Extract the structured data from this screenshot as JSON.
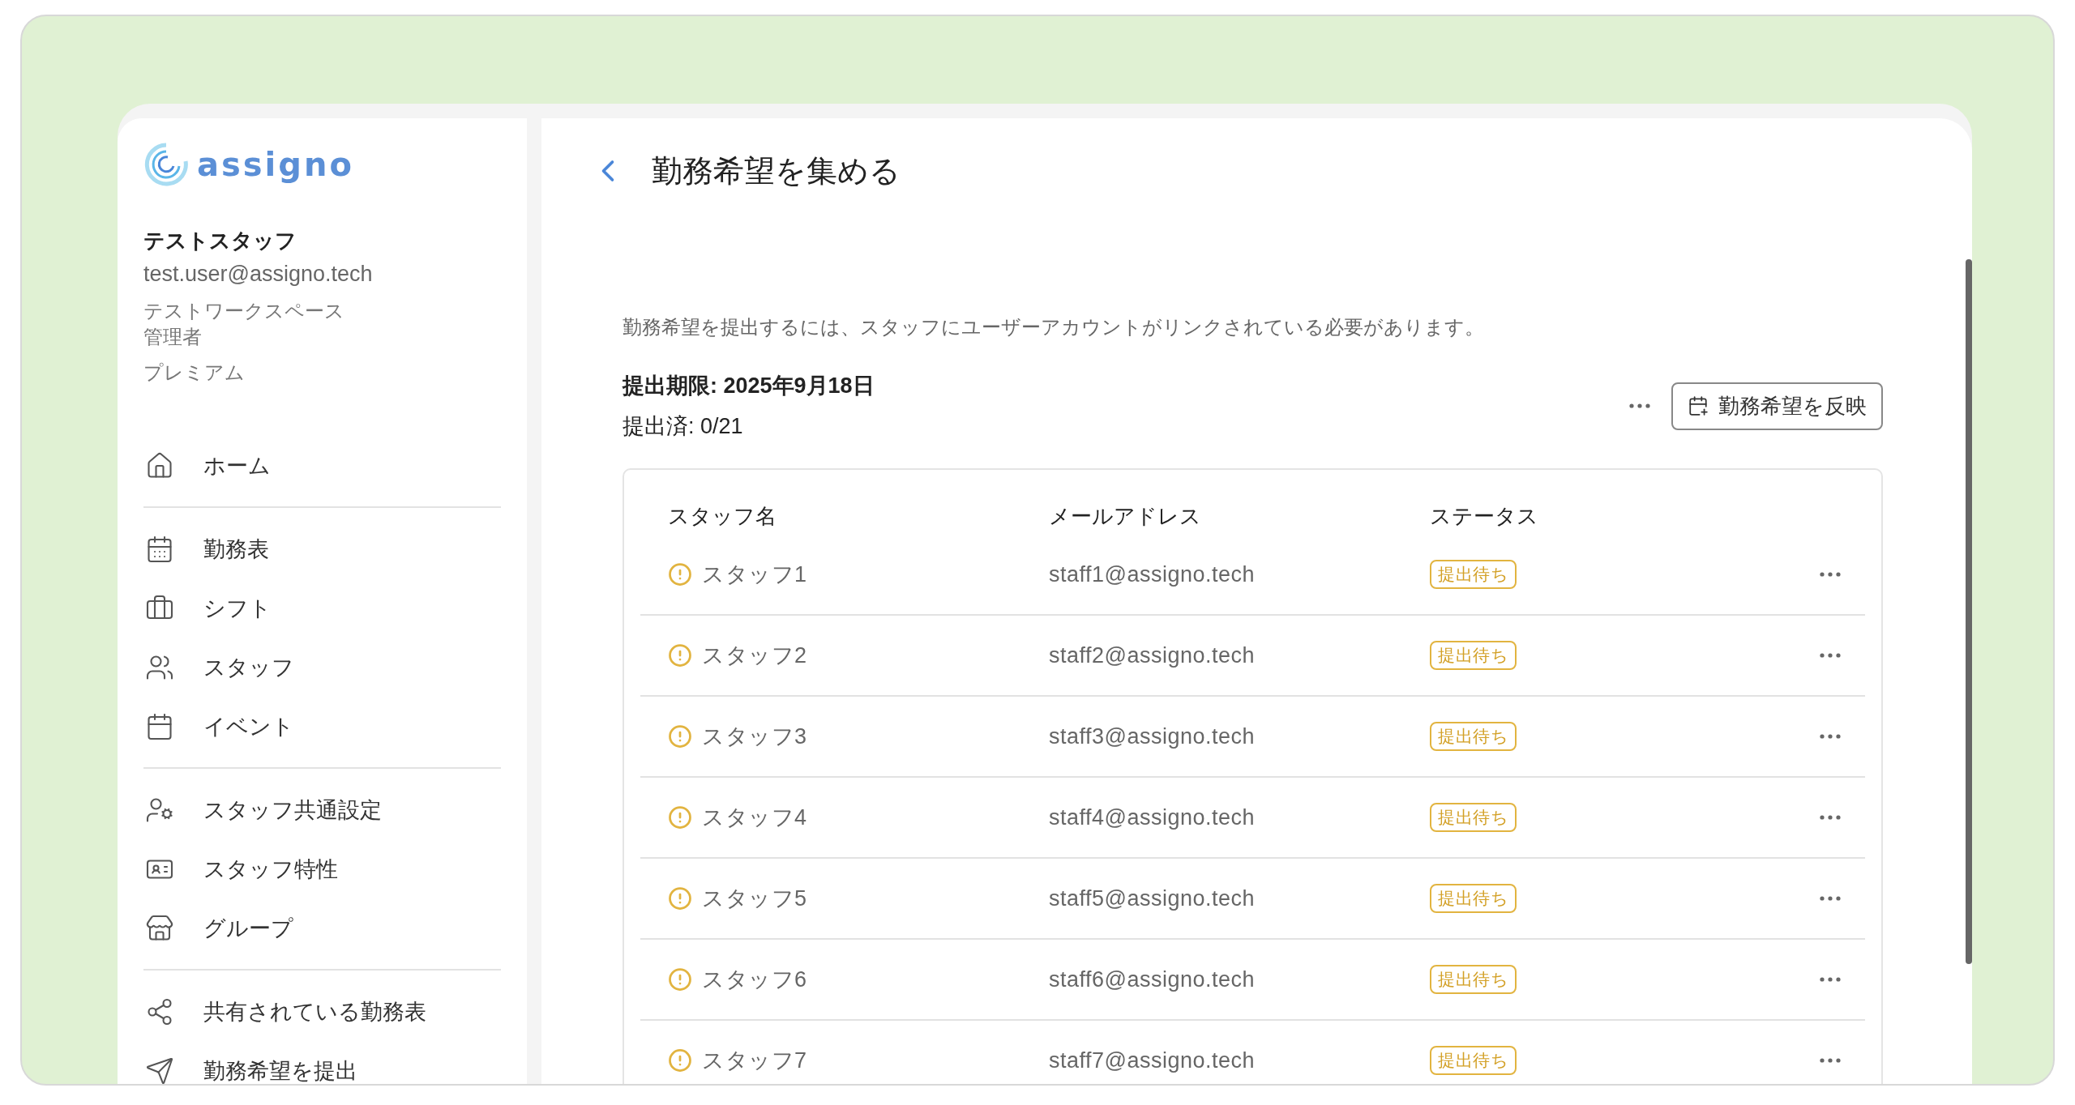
{
  "logo": {
    "text": "assigno"
  },
  "user": {
    "name": "テストスタッフ",
    "email": "test.user@assigno.tech",
    "workspace": "テストワークスペース",
    "role": "管理者",
    "plan": "プレミアム"
  },
  "sidebar": {
    "groups": [
      {
        "items": [
          {
            "label": "ホーム"
          }
        ]
      },
      {
        "items": [
          {
            "label": "勤務表"
          },
          {
            "label": "シフト"
          },
          {
            "label": "スタッフ"
          },
          {
            "label": "イベント"
          }
        ]
      },
      {
        "items": [
          {
            "label": "スタッフ共通設定"
          },
          {
            "label": "スタッフ特性"
          },
          {
            "label": "グループ"
          }
        ]
      },
      {
        "items": [
          {
            "label": "共有されている勤務表"
          },
          {
            "label": "勤務希望を提出"
          }
        ]
      }
    ]
  },
  "page": {
    "title": "勤務希望を集める",
    "note": "勤務希望を提出するには、スタッフにユーザーアカウントがリンクされている必要があります。",
    "deadline": "提出期限: 2025年9月18日",
    "submitted": "提出済: 0/21",
    "apply_button": "勤務希望を反映"
  },
  "table": {
    "columns": [
      "スタッフ名",
      "メールアドレス",
      "ステータス"
    ],
    "rows": [
      {
        "name": "スタッフ1",
        "email": "staff1@assigno.tech",
        "status": "提出待ち"
      },
      {
        "name": "スタッフ2",
        "email": "staff2@assigno.tech",
        "status": "提出待ち"
      },
      {
        "name": "スタッフ3",
        "email": "staff3@assigno.tech",
        "status": "提出待ち"
      },
      {
        "name": "スタッフ4",
        "email": "staff4@assigno.tech",
        "status": "提出待ち"
      },
      {
        "name": "スタッフ5",
        "email": "staff5@assigno.tech",
        "status": "提出待ち"
      },
      {
        "name": "スタッフ6",
        "email": "staff6@assigno.tech",
        "status": "提出待ち"
      },
      {
        "name": "スタッフ7",
        "email": "staff7@assigno.tech",
        "status": "提出待ち"
      }
    ]
  }
}
